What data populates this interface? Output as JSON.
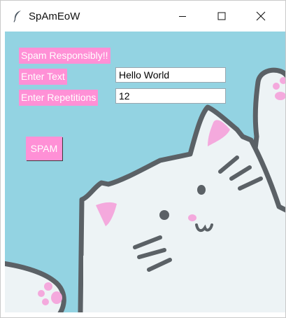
{
  "window": {
    "title": "SpAmEoW",
    "controls": {
      "minimize": "minimize-icon",
      "maximize": "maximize-icon",
      "close": "close-icon"
    }
  },
  "colors": {
    "background": "#93d3e2",
    "label_bg": "#ff90d6",
    "label_text": "#ffffff"
  },
  "form": {
    "heading": "Spam Responsibly!!",
    "text_label": "Enter Text",
    "text_value": "Hello World",
    "repetitions_label": "Enter Repetitions",
    "repetitions_value": "12",
    "submit_label": "SPAM"
  },
  "illustration": "cat-illustration"
}
